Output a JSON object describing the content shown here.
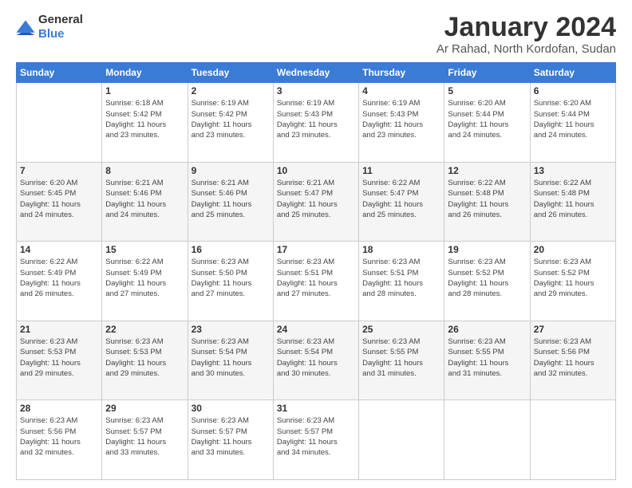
{
  "header": {
    "logo": {
      "text_general": "General",
      "text_blue": "Blue"
    },
    "title": "January 2024",
    "subtitle": "Ar Rahad, North Kordofan, Sudan"
  },
  "weekdays": [
    "Sunday",
    "Monday",
    "Tuesday",
    "Wednesday",
    "Thursday",
    "Friday",
    "Saturday"
  ],
  "weeks": [
    [
      {
        "day": "",
        "info": ""
      },
      {
        "day": "1",
        "info": "Sunrise: 6:18 AM\nSunset: 5:42 PM\nDaylight: 11 hours\nand 23 minutes."
      },
      {
        "day": "2",
        "info": "Sunrise: 6:19 AM\nSunset: 5:42 PM\nDaylight: 11 hours\nand 23 minutes."
      },
      {
        "day": "3",
        "info": "Sunrise: 6:19 AM\nSunset: 5:43 PM\nDaylight: 11 hours\nand 23 minutes."
      },
      {
        "day": "4",
        "info": "Sunrise: 6:19 AM\nSunset: 5:43 PM\nDaylight: 11 hours\nand 23 minutes."
      },
      {
        "day": "5",
        "info": "Sunrise: 6:20 AM\nSunset: 5:44 PM\nDaylight: 11 hours\nand 24 minutes."
      },
      {
        "day": "6",
        "info": "Sunrise: 6:20 AM\nSunset: 5:44 PM\nDaylight: 11 hours\nand 24 minutes."
      }
    ],
    [
      {
        "day": "7",
        "info": "Sunrise: 6:20 AM\nSunset: 5:45 PM\nDaylight: 11 hours\nand 24 minutes."
      },
      {
        "day": "8",
        "info": "Sunrise: 6:21 AM\nSunset: 5:46 PM\nDaylight: 11 hours\nand 24 minutes."
      },
      {
        "day": "9",
        "info": "Sunrise: 6:21 AM\nSunset: 5:46 PM\nDaylight: 11 hours\nand 25 minutes."
      },
      {
        "day": "10",
        "info": "Sunrise: 6:21 AM\nSunset: 5:47 PM\nDaylight: 11 hours\nand 25 minutes."
      },
      {
        "day": "11",
        "info": "Sunrise: 6:22 AM\nSunset: 5:47 PM\nDaylight: 11 hours\nand 25 minutes."
      },
      {
        "day": "12",
        "info": "Sunrise: 6:22 AM\nSunset: 5:48 PM\nDaylight: 11 hours\nand 26 minutes."
      },
      {
        "day": "13",
        "info": "Sunrise: 6:22 AM\nSunset: 5:48 PM\nDaylight: 11 hours\nand 26 minutes."
      }
    ],
    [
      {
        "day": "14",
        "info": "Sunrise: 6:22 AM\nSunset: 5:49 PM\nDaylight: 11 hours\nand 26 minutes."
      },
      {
        "day": "15",
        "info": "Sunrise: 6:22 AM\nSunset: 5:49 PM\nDaylight: 11 hours\nand 27 minutes."
      },
      {
        "day": "16",
        "info": "Sunrise: 6:23 AM\nSunset: 5:50 PM\nDaylight: 11 hours\nand 27 minutes."
      },
      {
        "day": "17",
        "info": "Sunrise: 6:23 AM\nSunset: 5:51 PM\nDaylight: 11 hours\nand 27 minutes."
      },
      {
        "day": "18",
        "info": "Sunrise: 6:23 AM\nSunset: 5:51 PM\nDaylight: 11 hours\nand 28 minutes."
      },
      {
        "day": "19",
        "info": "Sunrise: 6:23 AM\nSunset: 5:52 PM\nDaylight: 11 hours\nand 28 minutes."
      },
      {
        "day": "20",
        "info": "Sunrise: 6:23 AM\nSunset: 5:52 PM\nDaylight: 11 hours\nand 29 minutes."
      }
    ],
    [
      {
        "day": "21",
        "info": "Sunrise: 6:23 AM\nSunset: 5:53 PM\nDaylight: 11 hours\nand 29 minutes."
      },
      {
        "day": "22",
        "info": "Sunrise: 6:23 AM\nSunset: 5:53 PM\nDaylight: 11 hours\nand 29 minutes."
      },
      {
        "day": "23",
        "info": "Sunrise: 6:23 AM\nSunset: 5:54 PM\nDaylight: 11 hours\nand 30 minutes."
      },
      {
        "day": "24",
        "info": "Sunrise: 6:23 AM\nSunset: 5:54 PM\nDaylight: 11 hours\nand 30 minutes."
      },
      {
        "day": "25",
        "info": "Sunrise: 6:23 AM\nSunset: 5:55 PM\nDaylight: 11 hours\nand 31 minutes."
      },
      {
        "day": "26",
        "info": "Sunrise: 6:23 AM\nSunset: 5:55 PM\nDaylight: 11 hours\nand 31 minutes."
      },
      {
        "day": "27",
        "info": "Sunrise: 6:23 AM\nSunset: 5:56 PM\nDaylight: 11 hours\nand 32 minutes."
      }
    ],
    [
      {
        "day": "28",
        "info": "Sunrise: 6:23 AM\nSunset: 5:56 PM\nDaylight: 11 hours\nand 32 minutes."
      },
      {
        "day": "29",
        "info": "Sunrise: 6:23 AM\nSunset: 5:57 PM\nDaylight: 11 hours\nand 33 minutes."
      },
      {
        "day": "30",
        "info": "Sunrise: 6:23 AM\nSunset: 5:57 PM\nDaylight: 11 hours\nand 33 minutes."
      },
      {
        "day": "31",
        "info": "Sunrise: 6:23 AM\nSunset: 5:57 PM\nDaylight: 11 hours\nand 34 minutes."
      },
      {
        "day": "",
        "info": ""
      },
      {
        "day": "",
        "info": ""
      },
      {
        "day": "",
        "info": ""
      }
    ]
  ]
}
